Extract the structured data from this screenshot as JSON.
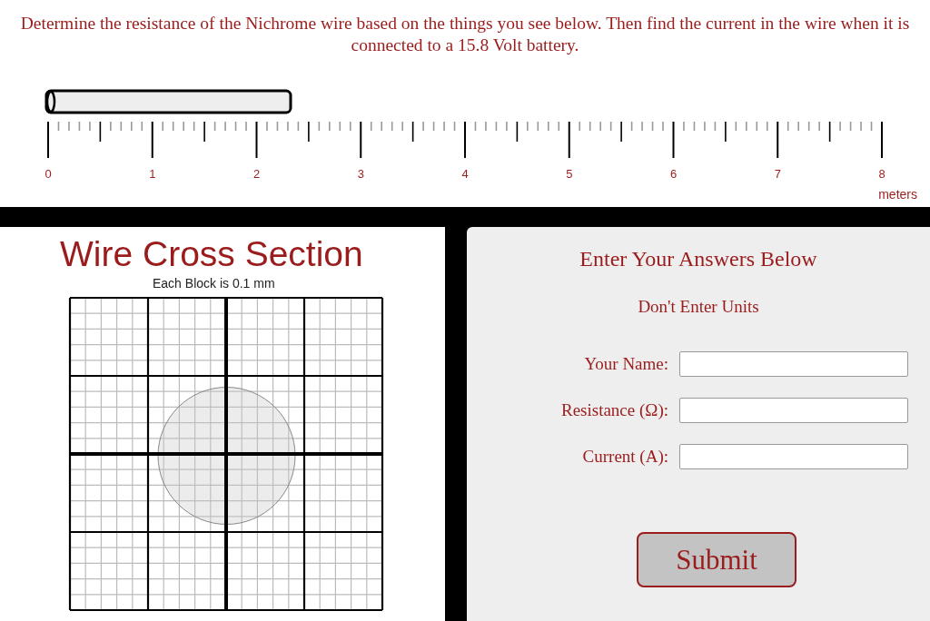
{
  "instructions": "Determine the resistance of the Nichrome wire based on the things you see below. Then find the current in the wire when it is connected to a 15.8 Volt battery.",
  "ruler": {
    "labels": [
      "0",
      "1",
      "2",
      "3",
      "4",
      "5",
      "6",
      "7",
      "8"
    ],
    "unit": "meters"
  },
  "cross_section": {
    "title": "Wire Cross Section",
    "subtitle": "Each Block is 0.1 mm"
  },
  "answers": {
    "title": "Enter Your Answers Below",
    "note": "Don't Enter Units",
    "fields": [
      {
        "label": "Your Name:"
      },
      {
        "label": "Resistance (Ω):"
      },
      {
        "label": "Current (A):"
      }
    ],
    "submit": "Submit"
  }
}
